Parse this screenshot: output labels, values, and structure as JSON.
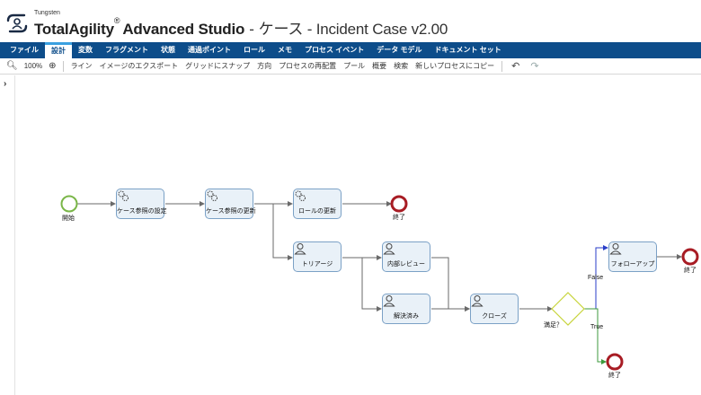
{
  "app": {
    "vendor": "Tungsten",
    "product": "TotalAgility",
    "reg_mark": "®",
    "studio": "Advanced Studio",
    "separator": "-",
    "case_title": "ケース - Incident Case v2.00"
  },
  "menu": {
    "items": [
      "ファイル",
      "設計",
      "変数",
      "フラグメント",
      "状態",
      "通過ポイント",
      "ロール",
      "メモ",
      "プロセス イベント",
      "データ モデル",
      "ドキュメント セット"
    ],
    "active_index": 1
  },
  "toolbar": {
    "zoom": "100%",
    "items": [
      "ライン",
      "イメージのエクスポート",
      "グリッドにスナップ",
      "方向",
      "プロセスの再配置",
      "プール",
      "概要",
      "検索",
      "新しいプロセスにコピー"
    ]
  },
  "icons": {
    "zoom_out": "zoom-out-icon",
    "zoom_in": "zoom-in-icon",
    "undo": "undo-icon",
    "redo": "redo-icon",
    "expand": "chevron-right-icon",
    "auto_activity": "gears-icon",
    "human_activity": "person-icon"
  },
  "colors": {
    "menu_bg": "#0d4d8a",
    "start_event": "#7ab648",
    "end_event": "#a81c24",
    "decision": "#c8d43c",
    "false_flow": "#2a3ec8",
    "true_flow": "#3c9a3c",
    "node_fill": "#e9f1f8",
    "node_border": "#7ba1c6"
  },
  "diagram": {
    "start_label": "開始",
    "end_label": "終了",
    "activities": {
      "set_case_ref": "ケース参照の設定",
      "update_case_ref": "ケース参照の更新",
      "update_role": "ロールの更新",
      "triage": "トリアージ",
      "internal_review": "内部レビュー",
      "resolved": "解決済み",
      "close": "クローズ",
      "follow_up": "フォローアップ"
    },
    "decision_label": "満足？",
    "false_label": "False",
    "true_label": "True"
  }
}
